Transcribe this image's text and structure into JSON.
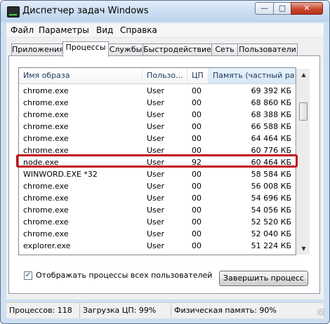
{
  "window": {
    "title": "Диспетчер задач Windows",
    "buttons": {
      "minimize": "—",
      "maximize": "□",
      "close": "✕"
    }
  },
  "menu": [
    "Файл",
    "Параметры",
    "Вид",
    "Справка"
  ],
  "tabs": [
    "Приложения",
    "Процессы",
    "Службы",
    "Быстродействие",
    "Сеть",
    "Пользователи"
  ],
  "active_tab": "Процессы",
  "columns": [
    "Имя образа",
    "Пользо...",
    "ЦП",
    "Память (частный ра..."
  ],
  "processes": [
    {
      "name": "chrome.exe",
      "user": "User",
      "cpu": "00",
      "mem": "69 392 КБ"
    },
    {
      "name": "chrome.exe",
      "user": "User",
      "cpu": "00",
      "mem": "68 860 КБ"
    },
    {
      "name": "chrome.exe",
      "user": "User",
      "cpu": "00",
      "mem": "68 388 КБ"
    },
    {
      "name": "chrome.exe",
      "user": "User",
      "cpu": "00",
      "mem": "66 588 КБ"
    },
    {
      "name": "chrome.exe",
      "user": "User",
      "cpu": "00",
      "mem": "64 464 КБ"
    },
    {
      "name": "chrome.exe",
      "user": "User",
      "cpu": "00",
      "mem": "60 776 КБ"
    },
    {
      "name": "node.exe",
      "user": "User",
      "cpu": "92",
      "mem": "60 464 КБ"
    },
    {
      "name": "WINWORD.EXE *32",
      "user": "User",
      "cpu": "00",
      "mem": "58 584 КБ"
    },
    {
      "name": "chrome.exe",
      "user": "User",
      "cpu": "00",
      "mem": "56 008 КБ"
    },
    {
      "name": "chrome.exe",
      "user": "User",
      "cpu": "00",
      "mem": "54 696 КБ"
    },
    {
      "name": "chrome.exe",
      "user": "User",
      "cpu": "00",
      "mem": "54 056 КБ"
    },
    {
      "name": "chrome.exe",
      "user": "User",
      "cpu": "00",
      "mem": "52 520 КБ"
    },
    {
      "name": "chrome.exe",
      "user": "User",
      "cpu": "00",
      "mem": "52 040 КБ"
    },
    {
      "name": "explorer.exe",
      "user": "User",
      "cpu": "00",
      "mem": "51 224 КБ"
    }
  ],
  "highlighted_process": "node.exe",
  "show_all_users": {
    "label": "Отображать процессы всех пользователей",
    "checked": true
  },
  "end_process_button": "Завершить процесс",
  "status": {
    "processes": "Процессов: 118",
    "cpu": "Загрузка ЦП: 99%",
    "memory": "Физическая память: 90%"
  },
  "colors": {
    "highlight_border": "#c0121c",
    "sorted_column": "#d4e7f8"
  }
}
